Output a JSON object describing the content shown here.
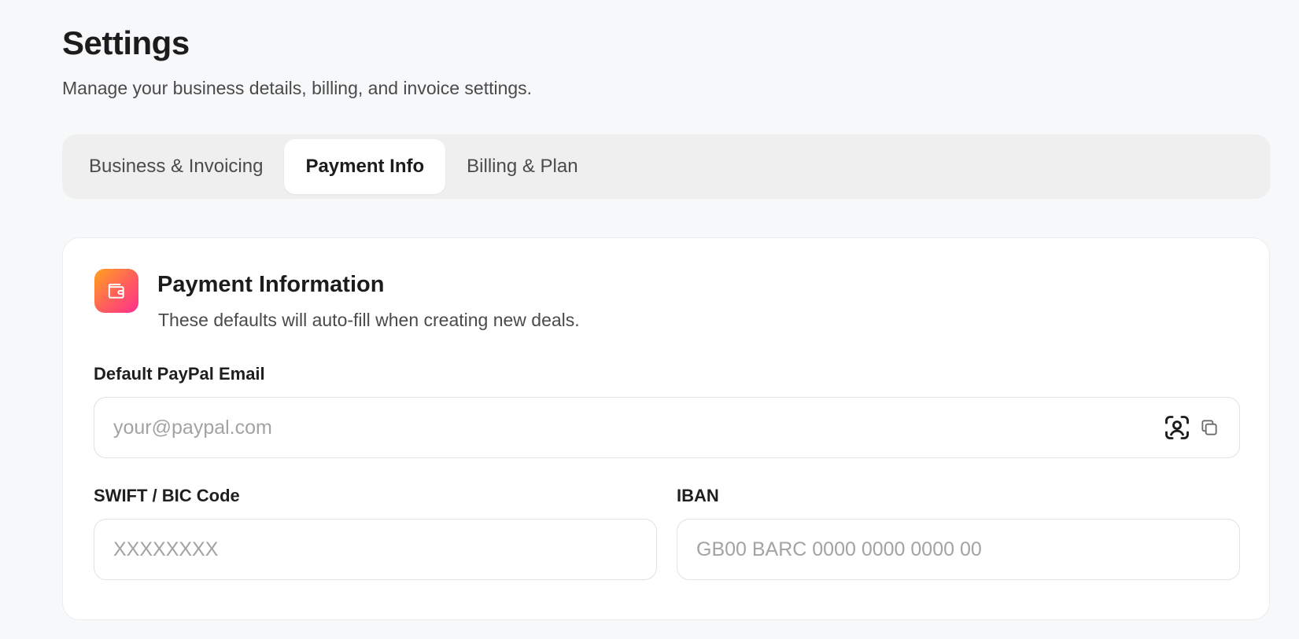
{
  "header": {
    "title": "Settings",
    "subtitle": "Manage your business details, billing, and invoice settings."
  },
  "tabs": [
    {
      "label": "Business & Invoicing",
      "active": false
    },
    {
      "label": "Payment Info",
      "active": true
    },
    {
      "label": "Billing & Plan",
      "active": false
    }
  ],
  "card": {
    "icon": "wallet-icon",
    "accent_gradient": [
      "#ffa21f",
      "#ff2f8e"
    ],
    "title": "Payment Information",
    "subtitle": "These defaults will auto-fill when creating new deals.",
    "fields": {
      "paypal": {
        "label": "Default PayPal Email",
        "value": "",
        "placeholder": "your@paypal.com",
        "icons": [
          "contact-scan-icon",
          "copy-icon"
        ]
      },
      "swift": {
        "label": "SWIFT / BIC Code",
        "value": "",
        "placeholder": "XXXXXXXX"
      },
      "iban": {
        "label": "IBAN",
        "value": "",
        "placeholder": "GB00 BARC 0000 0000 0000 00"
      }
    }
  }
}
